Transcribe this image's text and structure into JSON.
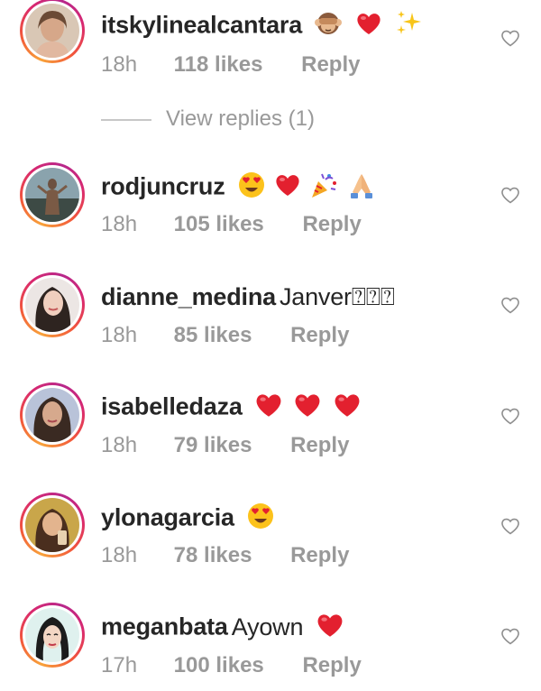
{
  "comments": [
    {
      "username": "itskylinealcantara",
      "text": "",
      "emojis": [
        "see-no-evil-monkey-emoji",
        "red-heart-emoji",
        "sparkles-emoji"
      ],
      "time": "18h",
      "likes": "118 likes",
      "reply": "Reply"
    },
    {
      "username": "rodjuncruz",
      "text": "",
      "emojis": [
        "heart-eyes-emoji",
        "red-heart-emoji",
        "party-popper-emoji",
        "folded-hands-emoji"
      ],
      "time": "18h",
      "likes": "105 likes",
      "reply": "Reply"
    },
    {
      "username": "dianne_medina",
      "text": "Janver⍰⍰⍰",
      "emojis": [],
      "time": "18h",
      "likes": "85 likes",
      "reply": "Reply"
    },
    {
      "username": "isabelledaza",
      "text": "",
      "emojis": [
        "red-heart-emoji",
        "red-heart-emoji",
        "red-heart-emoji"
      ],
      "time": "18h",
      "likes": "79 likes",
      "reply": "Reply"
    },
    {
      "username": "ylonagarcia",
      "text": "",
      "emojis": [
        "heart-eyes-emoji"
      ],
      "time": "18h",
      "likes": "78 likes",
      "reply": "Reply"
    },
    {
      "username": "meganbata",
      "text": "Ayown",
      "emojis": [
        "red-heart-emoji"
      ],
      "time": "17h",
      "likes": "100 likes",
      "reply": "Reply"
    }
  ],
  "view_replies": "View replies (1)",
  "colors": {
    "text": "#262626",
    "meta": "#999999",
    "ring_start": "#f8a23a",
    "ring_end": "#b7278b",
    "heart": "#e3202f"
  }
}
